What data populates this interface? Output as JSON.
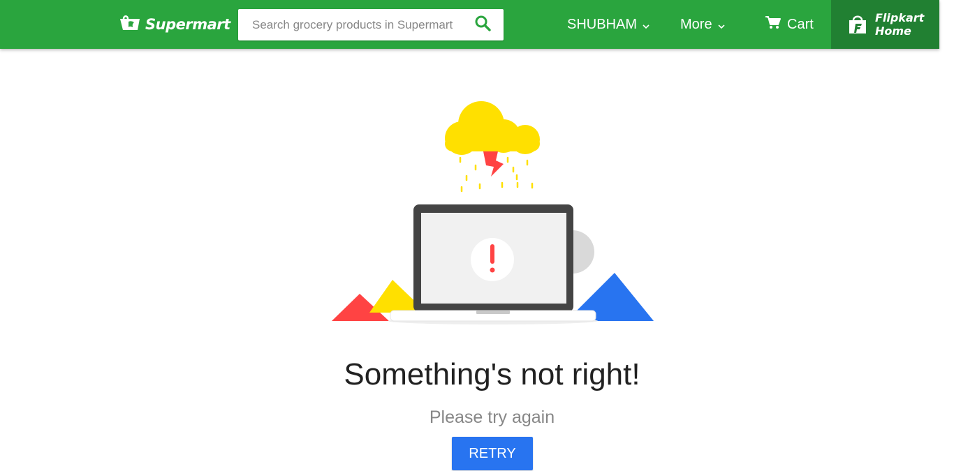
{
  "header": {
    "logo_text": "Supermart",
    "search_placeholder": "Search grocery products in Supermart",
    "user_label": "SHUBHAM",
    "more_label": "More",
    "cart_label": "Cart",
    "flipkart_home_line1": "Flipkart",
    "flipkart_home_line2": "Home"
  },
  "error": {
    "title": "Something's not right!",
    "subtitle": "Please try again",
    "retry_label": "RETRY"
  },
  "colors": {
    "header_green": "#2aa53e",
    "flipkart_home_bg": "#218032",
    "retry_blue": "#2874f0",
    "cloud_yellow": "#ffe000",
    "alert_red": "#ff4343"
  },
  "icons": [
    "supermart-logo-icon",
    "search-icon",
    "chevron-down-icon",
    "cart-icon",
    "flipkart-bag-icon",
    "error-illustration"
  ]
}
